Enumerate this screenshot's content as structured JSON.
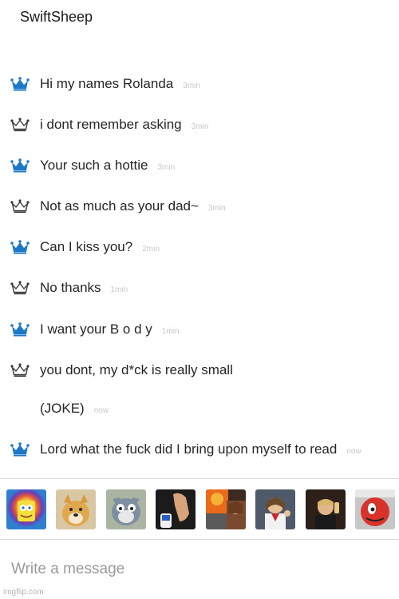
{
  "chat": {
    "title": "SwiftSheep",
    "messages": [
      {
        "text": "Hi my names Rolanda",
        "time": "3min",
        "crown": "blue"
      },
      {
        "text": "i dont remember asking",
        "time": "3min",
        "crown": "outline"
      },
      {
        "text": "Your such a hottie",
        "time": "3min",
        "crown": "blue"
      },
      {
        "text": "Not as much as your dad~",
        "time": "3min",
        "crown": "outline"
      },
      {
        "text": "Can I kiss you?",
        "time": "2min",
        "crown": "blue"
      },
      {
        "text": "No thanks",
        "time": "1min",
        "crown": "outline"
      },
      {
        "text": "I want your B o d y",
        "time": "1min",
        "crown": "blue"
      },
      {
        "text": "you dont, my d*ck is really small",
        "time": "",
        "crown": "outline"
      },
      {
        "text": "(JOKE)",
        "time": "now",
        "crown": "none"
      },
      {
        "text": "Lord what the fuck did I bring upon myself to read",
        "time": "now",
        "crown": "blue"
      }
    ]
  },
  "stickers": [
    {
      "name": "spongebob-rainbow-sticker",
      "icon": "spongebob-icon"
    },
    {
      "name": "doge-sticker",
      "icon": "doge-icon"
    },
    {
      "name": "tom-cat-sticker",
      "icon": "tom-cat-icon"
    },
    {
      "name": "hand-bottle-sticker",
      "icon": "hand-icon"
    },
    {
      "name": "disaster-girl-sticker",
      "icon": "disaster-girl-icon"
    },
    {
      "name": "buddy-jesus-sticker",
      "icon": "jesus-icon"
    },
    {
      "name": "toast-sticker",
      "icon": "toast-icon"
    },
    {
      "name": "red-character-sticker",
      "icon": "red-character-icon"
    }
  ],
  "composer": {
    "placeholder": "Write a message"
  },
  "watermark": "imgflip.com",
  "colors": {
    "crown_blue": "#1d78c9",
    "crown_outline": "#3a3a3a",
    "timestamp": "#c8c8c8",
    "divider": "#d8d8d8"
  }
}
